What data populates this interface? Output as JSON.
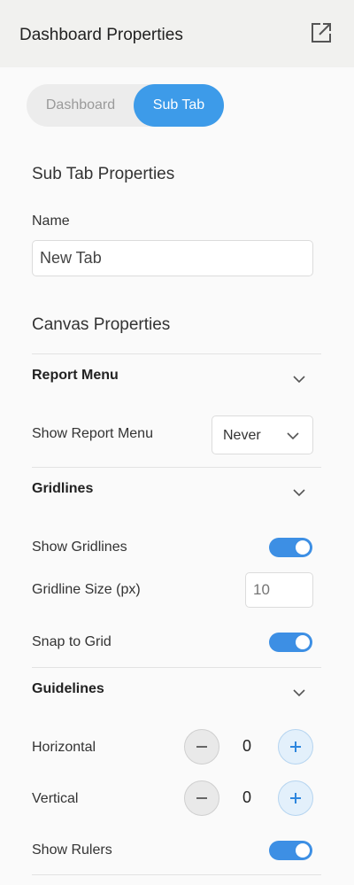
{
  "header": {
    "title": "Dashboard Properties",
    "popout_icon": "popout-icon"
  },
  "tabs": [
    {
      "label": "Dashboard",
      "active": false
    },
    {
      "label": "Sub Tab",
      "active": true
    }
  ],
  "colors": {
    "accent": "#3d9be9",
    "toggle_on": "#3d8fe4"
  },
  "sub_tab_properties": {
    "heading": "Sub Tab Properties",
    "name_label": "Name",
    "name_value": "New Tab"
  },
  "canvas_properties": {
    "heading": "Canvas Properties",
    "report_menu": {
      "title": "Report Menu",
      "show_label": "Show Report Menu",
      "show_value": "Never"
    },
    "gridlines": {
      "title": "Gridlines",
      "show_label": "Show Gridlines",
      "show_on": true,
      "size_label": "Gridline Size (px)",
      "size_placeholder": "10",
      "snap_label": "Snap to Grid",
      "snap_on": true
    },
    "guidelines": {
      "title": "Guidelines",
      "horizontal_label": "Horizontal",
      "horizontal_value": "0",
      "vertical_label": "Vertical",
      "vertical_value": "0",
      "rulers_label": "Show Rulers",
      "rulers_on": true
    }
  }
}
